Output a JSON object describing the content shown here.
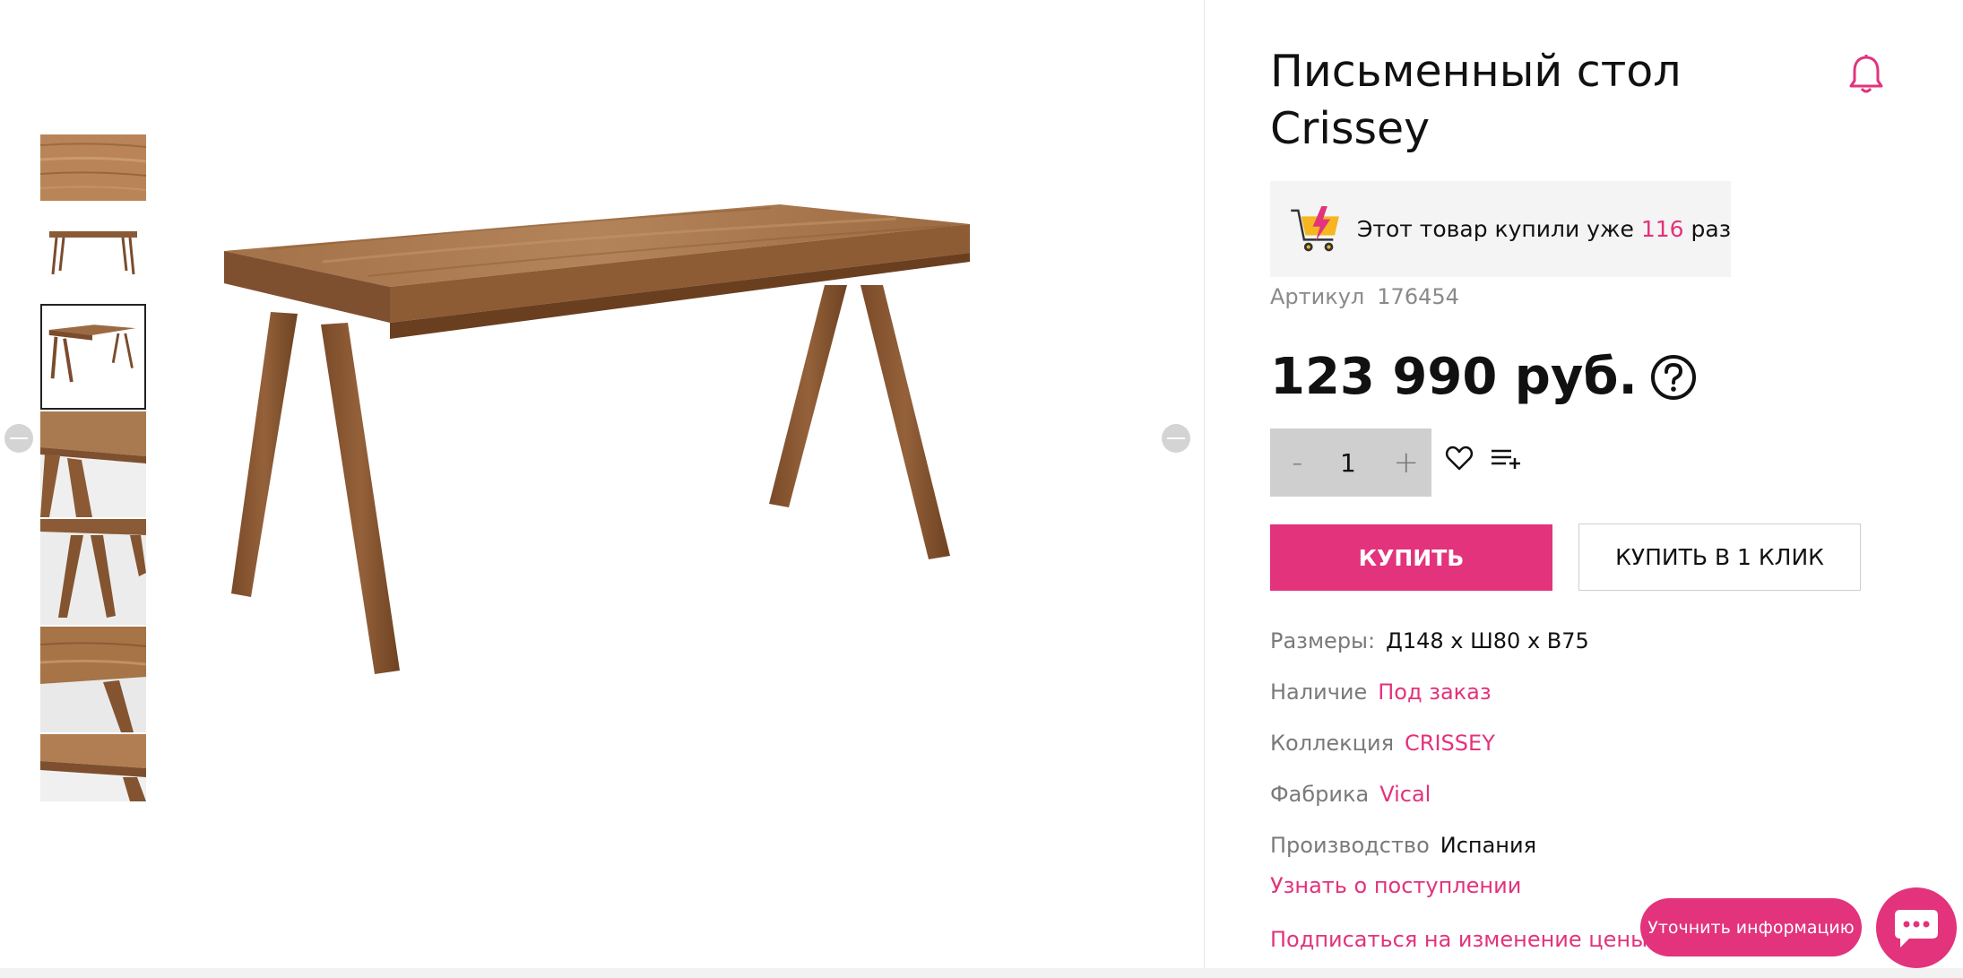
{
  "product": {
    "title": "Письменный стол Crissey",
    "sold_prefix": "Этот товар купили уже",
    "sold_count": "116",
    "sold_suffix": "раз",
    "sku_label": "Артикул",
    "sku_value": "176454",
    "price": "123 990 руб.",
    "quantity": "1",
    "qty_minus": "-",
    "qty_plus": "+"
  },
  "actions": {
    "buy_label": "КУПИТЬ",
    "buy_one_click_label": "КУПИТЬ В 1 КЛИК",
    "notify_label": "Узнать о поступлении",
    "subscribe_label": "Подписаться на изменение цены",
    "clarify_label": "Уточнить информацию"
  },
  "properties": [
    {
      "label": "Размеры:",
      "value": "Д148 х Ш80 х В75",
      "link": false
    },
    {
      "label": "Наличие",
      "value": "Под заказ",
      "link": true
    },
    {
      "label": "Коллекция",
      "value": "CRISSEY",
      "link": true
    },
    {
      "label": "Фабрика",
      "value": "Vical",
      "link": true
    },
    {
      "label": "Производство",
      "value": "Испания",
      "link": false
    }
  ],
  "gallery": {
    "thumbnails": [
      "wood-surface-closeup",
      "table-front-view",
      "table-angle-view",
      "table-corner-detail",
      "table-leg-detail",
      "table-top-leg-detail",
      "table-edge-detail"
    ],
    "active_index": 2
  },
  "icons": {
    "bell": "bell-icon",
    "cart": "cart-lightning-icon",
    "help": "question-circle-icon",
    "favorite": "heart-icon",
    "compare": "list-add-icon",
    "chat": "chat-bubble-icon",
    "prev": "arrow-left-icon",
    "next": "arrow-right-icon"
  },
  "colors": {
    "accent": "#e2337c",
    "qty_bg": "#cfcfcf",
    "sold_bg": "#f4f4f4",
    "muted_text": "#7a7a7a"
  }
}
